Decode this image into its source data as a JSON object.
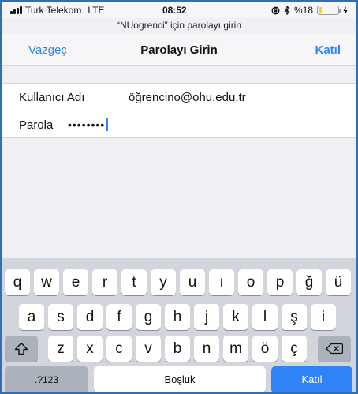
{
  "status_bar": {
    "carrier": "Turk Telekom",
    "network": "LTE",
    "time": "08:52",
    "battery": "%18",
    "battery_level": 0.18,
    "battery_color": "#f7d21b"
  },
  "prompt": "“NUogrenci” için parolayı girin",
  "nav": {
    "cancel_label": "Vazgeç",
    "title": "Parolayı Girin",
    "join_label": "Katıl"
  },
  "form": {
    "username_label": "Kullanıcı Adı",
    "username_value": "öğrencino@ohu.edu.tr",
    "password_label": "Parola",
    "password_value": "••••••••"
  },
  "keyboard": {
    "row1": [
      "q",
      "w",
      "e",
      "r",
      "t",
      "y",
      "u",
      "ı",
      "o",
      "p",
      "ğ",
      "ü"
    ],
    "row2": [
      "a",
      "s",
      "d",
      "f",
      "g",
      "h",
      "j",
      "k",
      "l",
      "ş",
      "i"
    ],
    "row3": [
      "z",
      "x",
      "c",
      "v",
      "b",
      "n",
      "m",
      "ö",
      "ç"
    ],
    "numbers_label": ".?123",
    "space_label": "Boşluk",
    "return_label": "Katıl",
    "shift_icon": "shift-icon",
    "delete_icon": "backspace-icon"
  },
  "colors": {
    "accent": "#2f83f5",
    "keyboard_bg": "#d2d5db",
    "function_key": "#acb2bc"
  }
}
